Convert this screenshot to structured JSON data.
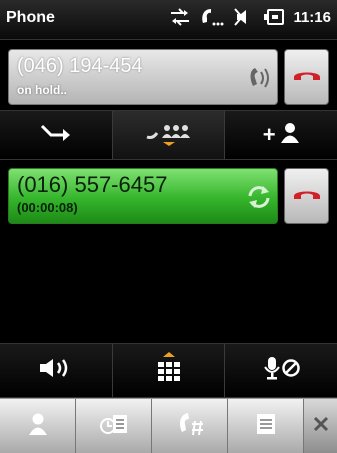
{
  "status_bar": {
    "app_title": "Phone",
    "time": "11:16",
    "icons": [
      "data-sync-icon",
      "call-in-progress-icon",
      "speaker-muted-icon",
      "battery-charging-icon"
    ]
  },
  "held_call": {
    "number": "(046) 194-454",
    "status": "on hold..",
    "icon": "phone-hold-icon"
  },
  "call_actions": [
    {
      "name": "transfer",
      "icon": "transfer-arrow-icon"
    },
    {
      "name": "conference",
      "icon": "conference-icon",
      "selected": true
    },
    {
      "name": "add-call",
      "icon": "add-contact-icon",
      "label": "+"
    }
  ],
  "active_call": {
    "number": "(016) 557-6457",
    "duration": "(00:00:08)",
    "icon": "swap-call-icon"
  },
  "audio_controls": [
    {
      "name": "speakerphone",
      "icon": "speaker-icon"
    },
    {
      "name": "keypad",
      "icon": "keypad-icon"
    },
    {
      "name": "mute",
      "icon": "mute-mic-icon"
    }
  ],
  "soft_keys": [
    {
      "name": "contacts",
      "icon": "contact-icon"
    },
    {
      "name": "call-history",
      "icon": "call-history-icon"
    },
    {
      "name": "dial-pad",
      "icon": "dial-pad-icon"
    },
    {
      "name": "menu",
      "icon": "menu-icon"
    }
  ],
  "colors": {
    "active_call": "#35b52c",
    "end_call": "#d0202a",
    "accent_arrow": "#f0a020"
  }
}
